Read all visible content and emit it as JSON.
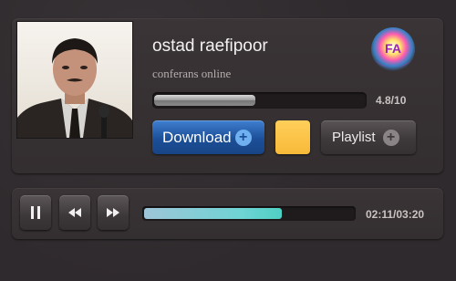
{
  "track": {
    "title": "ostad raefipoor",
    "subtitle": "conferans online",
    "rating_text": "4.8/10",
    "rating_fraction": 0.48
  },
  "logo": {
    "text": "FA"
  },
  "buttons": {
    "download_label": "Download",
    "playlist_label": "Playlist",
    "swatch_color": "#f8b938"
  },
  "player": {
    "time_text": "02:11/03:20",
    "progress_fraction": 0.655,
    "controls": [
      "pause-icon",
      "rewind-icon",
      "fast-forward-icon"
    ]
  },
  "colors": {
    "download_blue": "#1f56a3",
    "progress_teal": "#5ad4c9",
    "background": "#2f2a2d"
  }
}
